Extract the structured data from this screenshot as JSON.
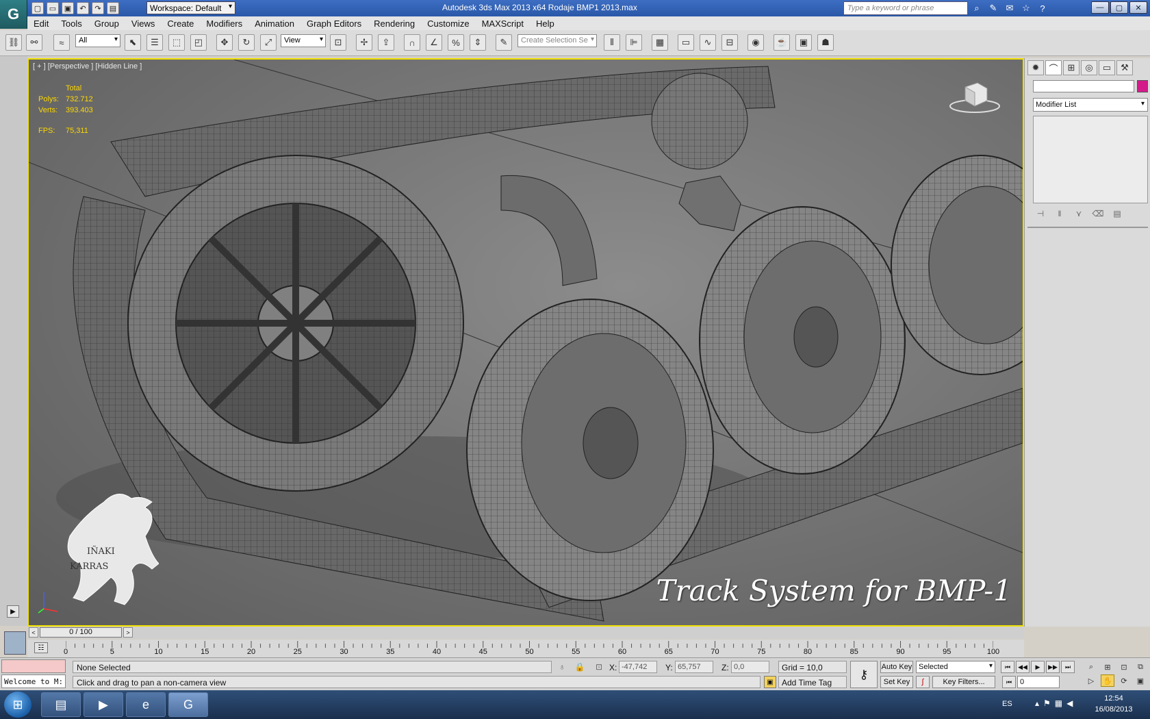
{
  "window": {
    "title": "Autodesk 3ds Max  2013 x64     Rodaje BMP1 2013.max",
    "workspace": "Workspace: Default",
    "search_placeholder": "Type a keyword or phrase"
  },
  "menu": [
    "Edit",
    "Tools",
    "Group",
    "Views",
    "Create",
    "Modifiers",
    "Animation",
    "Graph Editors",
    "Rendering",
    "Customize",
    "MAXScript",
    "Help"
  ],
  "toolbar": {
    "selection_filter": "All",
    "ref_coord": "View",
    "named_selection_placeholder": "Create Selection Se"
  },
  "viewport": {
    "label": "[ + ] [Perspective ] [Hidden Line ]",
    "stats": {
      "header": "Total",
      "polys_label": "Polys:",
      "polys": "732.712",
      "verts_label": "Verts:",
      "verts": "393.403",
      "fps_label": "FPS:",
      "fps": "75,311"
    },
    "overlay_title": "Track System for BMP-1",
    "logo_line1": "IÑAKI",
    "logo_line2": "KARRAS"
  },
  "command_panel": {
    "modifier_list": "Modifier List",
    "color": "#d31c8a"
  },
  "timeline": {
    "slider": "0 / 100",
    "ticks": [
      "0",
      "5",
      "10",
      "15",
      "20",
      "25",
      "30",
      "35",
      "40",
      "45",
      "50",
      "55",
      "60",
      "65",
      "70",
      "75",
      "80",
      "85",
      "90",
      "95",
      "100"
    ]
  },
  "status": {
    "welcome": "Welcome to M:",
    "selection": "None Selected",
    "prompt": "Click and drag to pan a non-camera view",
    "x_label": "X:",
    "x": "-47,742",
    "y_label": "Y:",
    "y": "65,757",
    "z_label": "Z:",
    "z": "0,0",
    "grid": "Grid = 10,0",
    "add_time_tag": "Add Time Tag",
    "auto_key": "Auto Key",
    "set_key": "Set Key",
    "key_mode": "Selected",
    "key_filters": "Key Filters...",
    "frame": "0"
  },
  "taskbar": {
    "lang": "ES",
    "time": "12:54",
    "date": "16/08/2013"
  }
}
